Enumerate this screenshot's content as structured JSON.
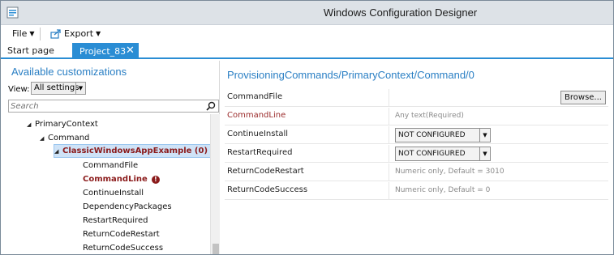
{
  "window": {
    "title": "Windows Configuration Designer"
  },
  "menu": {
    "file_label": "File",
    "export_label": "Export"
  },
  "tabs": {
    "start_page": "Start page",
    "project": "Project_83"
  },
  "left_panel": {
    "title": "Available customizations",
    "view_label": "View:",
    "view_selected": "All settings",
    "search_placeholder": "Search",
    "tree": [
      {
        "label": "PrimaryContext",
        "expanded": true,
        "error": false,
        "selected": false
      },
      {
        "label": "Command",
        "expanded": true,
        "error": false,
        "selected": false
      },
      {
        "label": "ClassicWindowsAppExample (0)",
        "expanded": true,
        "error": true,
        "selected": true
      },
      {
        "label": "CommandFile",
        "error": false
      },
      {
        "label": "CommandLine",
        "error": true
      },
      {
        "label": "ContinueInstall",
        "error": false
      },
      {
        "label": "DependencyPackages",
        "error": false
      },
      {
        "label": "RestartRequired",
        "error": false
      },
      {
        "label": "ReturnCodeRestart",
        "error": false
      },
      {
        "label": "ReturnCodeSuccess",
        "error": false
      }
    ]
  },
  "right_panel": {
    "path_title": "ProvisioningCommands/PrimaryContext/Command/0",
    "settings": [
      {
        "name": "CommandFile",
        "button": "Browse..."
      },
      {
        "name": "CommandLine",
        "hint": "Any text(Required)",
        "error": true
      },
      {
        "name": "ContinueInstall",
        "dropdown": "NOT CONFIGURED"
      },
      {
        "name": "RestartRequired",
        "dropdown": "NOT CONFIGURED"
      },
      {
        "name": "ReturnCodeRestart",
        "hint": "Numeric only, Default = 3010"
      },
      {
        "name": "ReturnCodeSuccess",
        "hint": "Numeric only, Default = 0"
      }
    ]
  },
  "colors": {
    "accent": "#2a8dd4",
    "title_blue": "#2a7fc4",
    "error": "#8b1b1b"
  },
  "icons": {
    "app": "wcd-app-icon",
    "export": "export-icon",
    "search": "search-icon",
    "error": "error-icon",
    "close": "close-icon"
  }
}
